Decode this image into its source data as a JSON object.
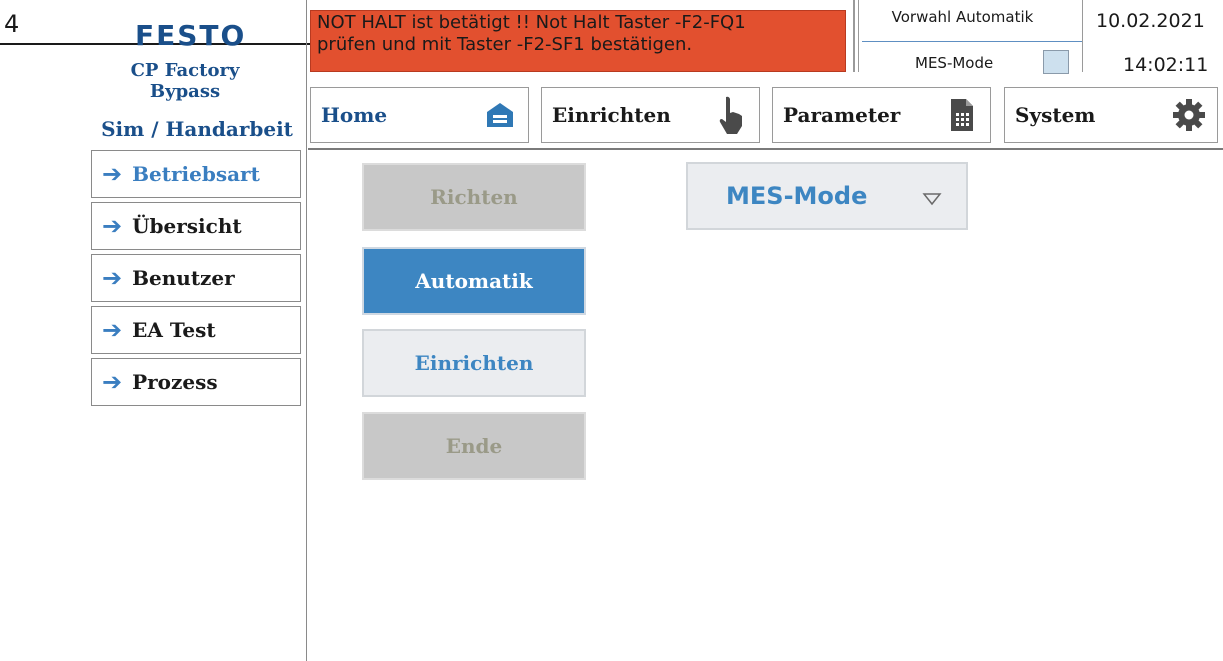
{
  "callout": {
    "number": "4"
  },
  "logo": {
    "text": "FESTO"
  },
  "station": {
    "line1": "CP Factory",
    "line2": "Bypass",
    "mode": "Sim / Handarbeit"
  },
  "alarm": {
    "line1": "NOT HALT ist betätigt !! Not Halt Taster -F2-FQ1",
    "line2": "prüfen und mit Taster -F2-SF1 bestätigen.",
    "color": "#e2502f"
  },
  "status": {
    "preselect": "Vorwahl Automatik",
    "mes_label": "MES-Mode",
    "date": "10.02.2021",
    "time": "14:02:11"
  },
  "nav": [
    {
      "label": "Home",
      "icon": "home-icon"
    },
    {
      "label": "Einrichten",
      "icon": "hand-pointer-icon"
    },
    {
      "label": "Parameter",
      "icon": "document-icon"
    },
    {
      "label": "System",
      "icon": "gear-icon"
    }
  ],
  "sidebar": [
    {
      "label": "Betriebsart",
      "icon": "arrow-right-icon",
      "active": true
    },
    {
      "label": "Übersicht",
      "icon": "arrow-right-icon",
      "active": false
    },
    {
      "label": "Benutzer",
      "icon": "arrow-right-icon",
      "active": false
    },
    {
      "label": "EA Test",
      "icon": "arrow-right-icon",
      "active": false
    },
    {
      "label": "Prozess",
      "icon": "arrow-right-icon",
      "active": false
    }
  ],
  "buttons": [
    {
      "label": "Richten",
      "state": "disabled"
    },
    {
      "label": "Automatik",
      "state": "selected"
    },
    {
      "label": "Einrichten",
      "state": "enabled"
    },
    {
      "label": "Ende",
      "state": "disabled"
    }
  ],
  "mes_dropdown": {
    "value": "MES-Mode",
    "icon": "chevron-down-icon"
  },
  "colors": {
    "accent": "#3d86c2",
    "brand": "#1a4f8a",
    "disabled": "#c8c8c8"
  }
}
